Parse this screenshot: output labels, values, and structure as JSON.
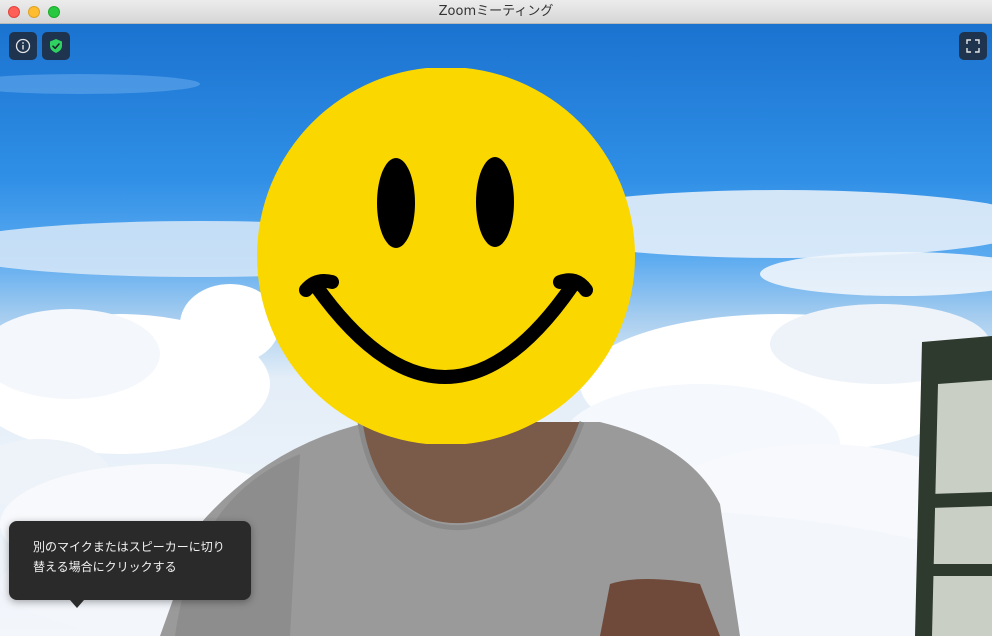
{
  "window": {
    "title": "Zoomミーティング"
  },
  "controls": {
    "info_icon": "info-icon",
    "security_icon": "shield-check-icon",
    "security_color": "#2fd160",
    "fullscreen_icon": "fullscreen-icon"
  },
  "tooltip": {
    "line1": "別のマイクまたはスピーカーに切り",
    "line2": "替える場合にクリックする"
  },
  "colors": {
    "emoji_face": "#fbd700",
    "tooltip_bg": "#2a2a2a",
    "shirt": "#9a9a9a"
  }
}
